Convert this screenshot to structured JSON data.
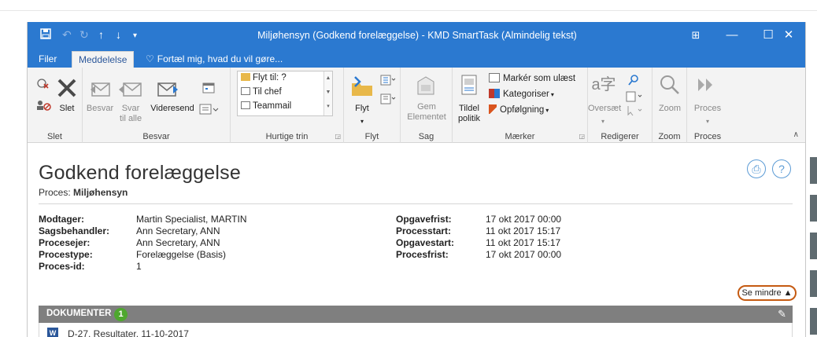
{
  "window": {
    "title": "Miljøhensyn (Godkend forelæggelse) - KMD SmartTask  (Almindelig tekst)",
    "controls": {
      "ribbon_options": "⊞",
      "minimize": "—",
      "maximize": "☐",
      "close": "✕"
    }
  },
  "tabs": {
    "file": "Filer",
    "message": "Meddelelse",
    "tell_me": "Fortæl mig, hvad du vil gøre..."
  },
  "ribbon": {
    "groups": {
      "slet": {
        "label": "Slet",
        "delete_label": "Slet"
      },
      "besvar": {
        "label": "Besvar",
        "reply": "Besvar",
        "reply_all_1": "Svar",
        "reply_all_2": "til alle",
        "forward": "Videresend"
      },
      "hurtige_trin": {
        "label": "Hurtige trin",
        "items": [
          "Flyt til: ?",
          "Til chef",
          "Teammail"
        ]
      },
      "flyt": {
        "label": "Flyt",
        "move": "Flyt"
      },
      "sag": {
        "label": "Sag",
        "save_1": "Gem",
        "save_2": "Elementet"
      },
      "maerker": {
        "label": "Mærker",
        "assign_1": "Tildel",
        "assign_2": "politik",
        "mark_unread": "Markér som ulæst",
        "categorize": "Kategoriser",
        "followup": "Opfølgning"
      },
      "redigerer": {
        "label": "Redigerer",
        "translate": "Oversæt"
      },
      "zoom": {
        "label": "Zoom",
        "zoom": "Zoom"
      },
      "proces": {
        "label": "Proces",
        "proces": "Proces"
      }
    }
  },
  "page": {
    "heading": "Godkend forelæggelse",
    "process_label": "Proces:",
    "process_value": "Miljøhensyn",
    "left_fields": [
      {
        "key": "Modtager:",
        "value": "Martin Specialist, MARTIN"
      },
      {
        "key": "Sagsbehandler:",
        "value": "Ann Secretary, ANN"
      },
      {
        "key": "Procesejer:",
        "value": "Ann Secretary, ANN"
      },
      {
        "key": "Procestype:",
        "value": "Forelæggelse (Basis)"
      },
      {
        "key": "Proces-id:",
        "value": "1"
      }
    ],
    "right_fields": [
      {
        "key": "Opgavefrist:",
        "value": "17 okt 2017 00:00"
      },
      {
        "key": "Processtart:",
        "value": "11 okt 2017 15:17"
      },
      {
        "key": "Opgavestart:",
        "value": "11 okt 2017 15:17"
      },
      {
        "key": "Procesfrist:",
        "value": "17 okt 2017 00:00"
      }
    ],
    "see_less": "Se mindre ▲",
    "documents": {
      "label": "DOKUMENTER",
      "count": "1",
      "items": [
        {
          "icon": "word-icon",
          "name": "D-27, Resultater, 11-10-2017"
        }
      ]
    }
  },
  "colors": {
    "titlebar": "#2b79d0",
    "ribbon_bg": "#f3f3f3",
    "docs_bar": "#7f7f7f",
    "badge_green": "#4ea72e",
    "see_less_border": "#c55a11",
    "word_blue": "#2b579a"
  }
}
